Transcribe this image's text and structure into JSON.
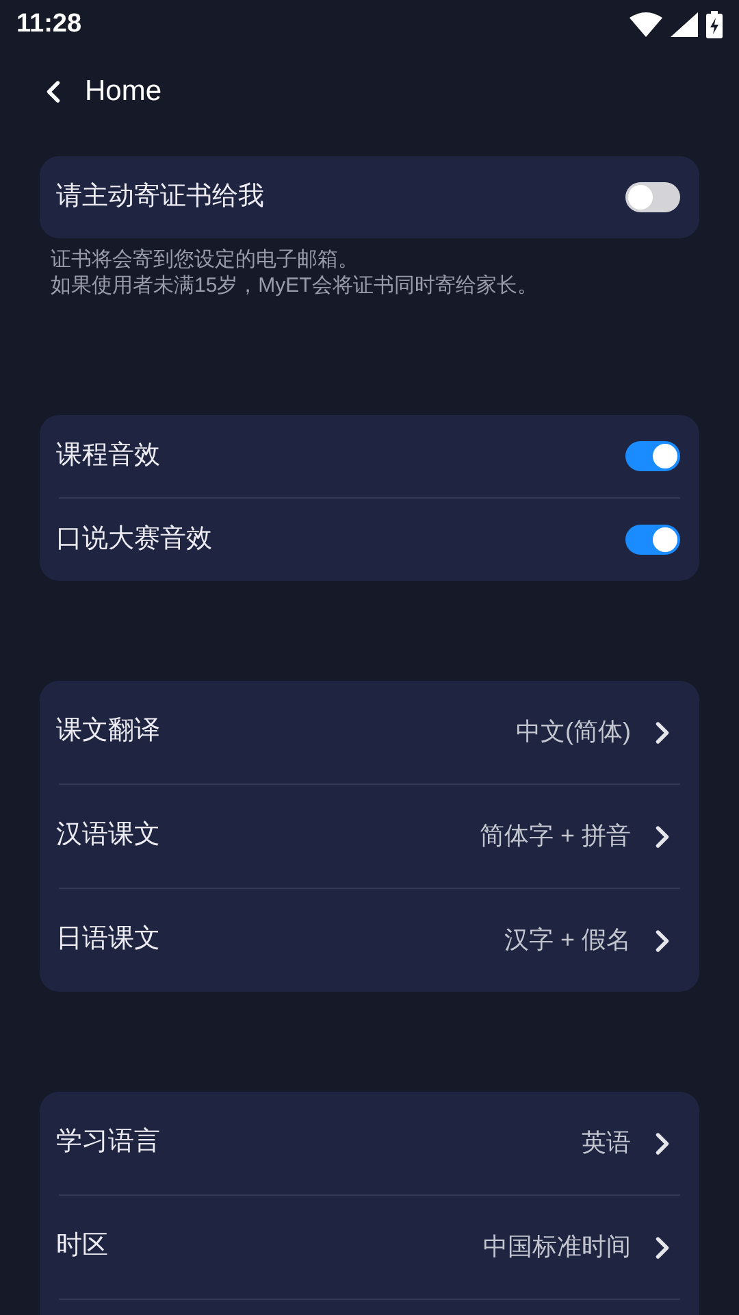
{
  "status_bar": {
    "time": "11:28"
  },
  "header": {
    "title": "Home"
  },
  "sections": [
    {
      "rows": [
        {
          "kind": "toggle",
          "label": "请主动寄证书给我",
          "on": false
        }
      ],
      "note": [
        "证书将会寄到您设定的电子邮箱。",
        "如果使用者未满15岁，MyET会将证书同时寄给家长。"
      ]
    },
    {
      "rows": [
        {
          "kind": "toggle",
          "label": "课程音效",
          "on": true
        },
        {
          "kind": "toggle",
          "label": "口说大赛音效",
          "on": true
        }
      ]
    },
    {
      "rows": [
        {
          "kind": "link",
          "label": "课文翻译",
          "value": "中文(简体)"
        },
        {
          "kind": "link",
          "label": "汉语课文",
          "value": "简体字 + 拼音"
        },
        {
          "kind": "link",
          "label": "日语课文",
          "value": "汉字 + 假名"
        }
      ]
    },
    {
      "rows": [
        {
          "kind": "link",
          "label": "学习语言",
          "value": "英语"
        },
        {
          "kind": "link",
          "label": "时区",
          "value": "中国标准时间"
        }
      ],
      "continues": true
    }
  ]
}
